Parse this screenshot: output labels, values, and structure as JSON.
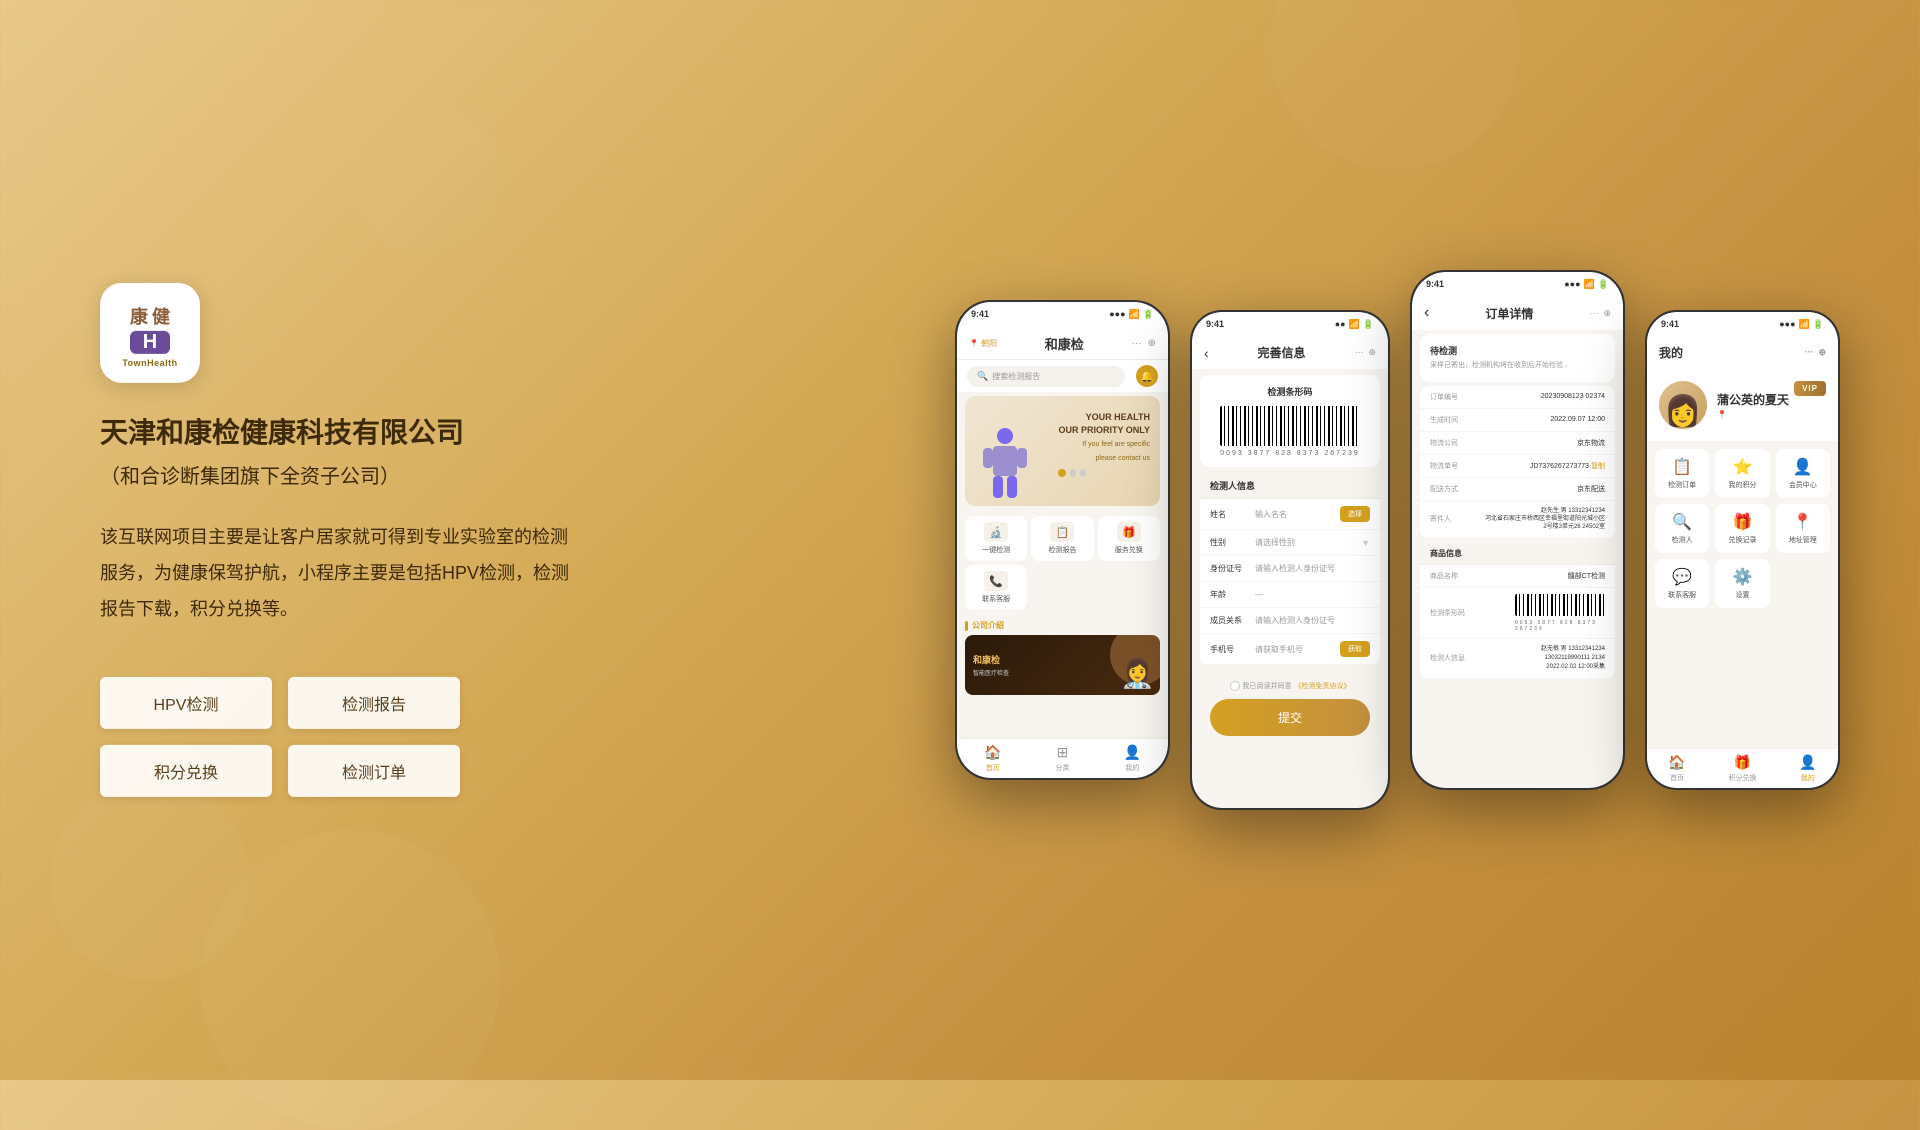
{
  "background": {
    "color": "#d4a955"
  },
  "company": {
    "name": "天津和康检健康科技有限公司",
    "subtitle": "（和合诊断集团旗下全资子公司）",
    "description": "该互联网项目主要是让客户居家就可得到专业实验室的检测服务，为健康保驾护航，小程序主要是包括HPV检测，检测报告下载，积分兑换等。",
    "app_icon_top_left": "康",
    "app_icon_top_right2": "健",
    "app_icon_brand": "TownHealth"
  },
  "tags": [
    {
      "label": "HPV检测"
    },
    {
      "label": "检测报告"
    },
    {
      "label": "积分兑换"
    },
    {
      "label": "检测订单"
    }
  ],
  "phone1": {
    "time": "9:41",
    "location": "朝阳",
    "title": "和康检",
    "search_placeholder": "搜索检测报告",
    "banner_line1": "YOUR HEALTH",
    "banner_line2": "OUR PRIORITY ONLY",
    "banner_line3": "If you feel are specific",
    "banner_line4": "please contact us",
    "grid_items": [
      {
        "icon": "🔬",
        "label": "一键检测"
      },
      {
        "icon": "📋",
        "label": "检测报告"
      },
      {
        "icon": "🎁",
        "label": "服务兑换"
      },
      {
        "icon": "📞",
        "label": "联系客服"
      }
    ],
    "section_title": "公司介绍",
    "company_card_title": "和康检",
    "company_card_sub": "智能医疗检查",
    "nav": [
      "首页",
      "分类",
      "我的"
    ]
  },
  "phone2": {
    "time": "9:41",
    "title": "完善信息",
    "barcode_section_title": "检测条形码",
    "barcode_numbers": "0093  3877  828  8373  267239",
    "form_title": "检测人信息",
    "fields": [
      {
        "label": "姓名",
        "placeholder": "输入名名",
        "has_btn": true,
        "btn": "选择"
      },
      {
        "label": "性别",
        "placeholder": "请选择性别",
        "has_dropdown": true
      },
      {
        "label": "身份证号",
        "placeholder": "请输入检测人身份证号"
      },
      {
        "label": "年龄",
        "placeholder": "—"
      },
      {
        "label": "成员关系",
        "placeholder": "请输入检测人身份证号"
      },
      {
        "label": "手机号",
        "placeholder": "请获取手机号",
        "has_btn": true,
        "btn": "获取"
      }
    ],
    "agree_text": "我已阅读并同意《检测免责协议》",
    "submit_btn": "提交"
  },
  "phone3": {
    "time": "9:41",
    "title": "订单详情",
    "status": "待检测",
    "status_desc": "采样已寄出，检测机构将在收到后开始检验...",
    "order_number_label": "订单编号",
    "order_number": "20230908123 02374",
    "create_time_label": "生成时间",
    "create_time": "2022.09.07 12:00",
    "logistics_label": "物流公司",
    "logistics_value": "京东物流",
    "tracking_label": "物流单号",
    "tracking_value": "JD7376267273773",
    "tracking_copy": "复制",
    "delivery_label": "配送方式",
    "delivery_value": "京东配送",
    "recipient_label": "寄件人",
    "recipient_value": "赵先生 男 13312341234",
    "recipient_address": "河北省石家庄市桥西区幸福里街道阳光城小区2号楼3单元26 24502室",
    "goods_title": "商品信息",
    "goods_name_label": "商品名称",
    "goods_name": "髓部CT检测",
    "barcode_label": "检测条形码",
    "barcode_numbers": "0093  3877  828  8373  267239",
    "info_label": "检测人信息",
    "info_value1": "赵无根 男 13312341234",
    "info_value2": "13032119990111 2134",
    "info_value3": "2022.02.02 12:00采集"
  },
  "phone4": {
    "time": "9:41",
    "title": "我的",
    "vip": "VIP",
    "user_name": "蒲公英的夏天",
    "user_loc": "📍",
    "menu_items": [
      {
        "icon": "📋",
        "label": "检测订单"
      },
      {
        "icon": "⭐",
        "label": "我的积分"
      },
      {
        "icon": "👤",
        "label": "会员中心"
      },
      {
        "icon": "🔍",
        "label": "检测人"
      },
      {
        "icon": "🎁",
        "label": "兑换记录"
      },
      {
        "icon": "📍",
        "label": "地址管理"
      },
      {
        "icon": "💬",
        "label": "联系客服"
      },
      {
        "icon": "⚙️",
        "label": "设置"
      }
    ],
    "nav": [
      "首页",
      "积分兑换",
      "我的"
    ]
  }
}
